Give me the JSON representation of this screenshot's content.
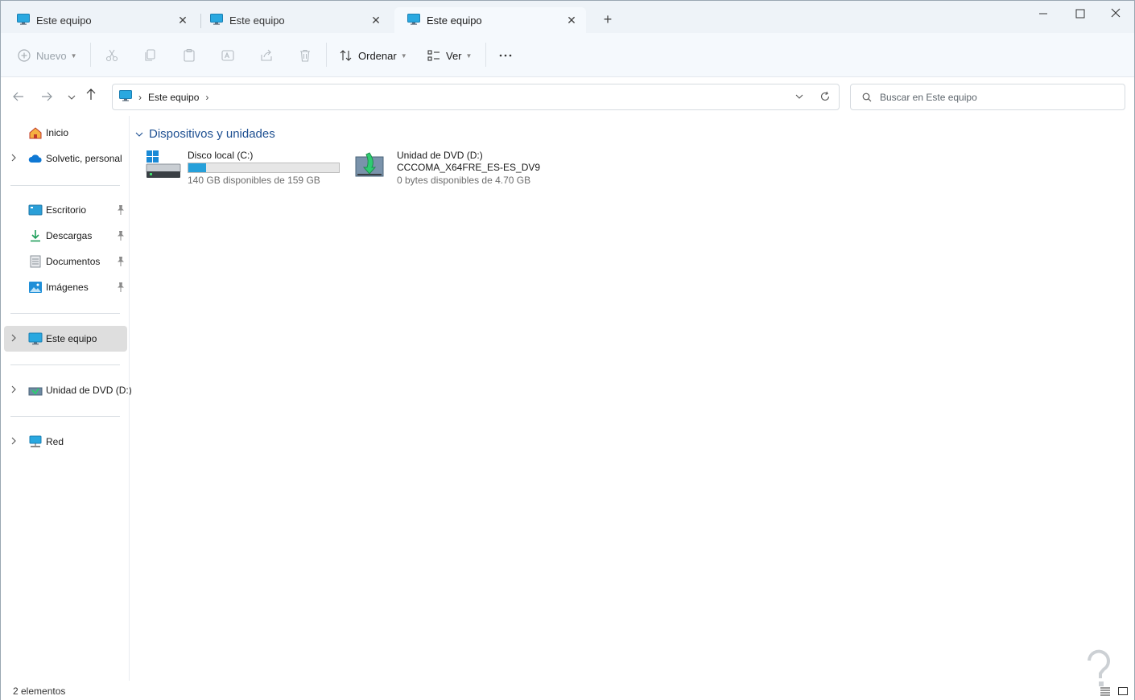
{
  "tabs": [
    {
      "label": "Este equipo",
      "active": false
    },
    {
      "label": "Este equipo",
      "active": false
    },
    {
      "label": "Este equipo",
      "active": true
    }
  ],
  "toolbar": {
    "new_label": "Nuevo",
    "sort_label": "Ordenar",
    "view_label": "Ver"
  },
  "address": {
    "crumbs": [
      "Este equipo"
    ]
  },
  "search": {
    "placeholder": "Buscar en Este equipo"
  },
  "sidebar": {
    "items": [
      {
        "label": "Inicio"
      },
      {
        "label": "Solvetic, personal"
      },
      {
        "label": "Escritorio"
      },
      {
        "label": "Descargas"
      },
      {
        "label": "Documentos"
      },
      {
        "label": "Imágenes"
      },
      {
        "label": "Este equipo"
      },
      {
        "label": "Unidad de DVD (D:)"
      },
      {
        "label": "Red"
      }
    ]
  },
  "content": {
    "group_title": "Dispositivos y unidades",
    "drives": [
      {
        "name": "Disco local (C:)",
        "info": "140 GB disponibles de 159 GB",
        "used_fraction": 0.12
      },
      {
        "name": "Unidad de DVD (D:)",
        "subtitle": "CCCOMA_X64FRE_ES-ES_DV9",
        "info": "0 bytes disponibles de 4.70 GB"
      }
    ]
  },
  "status": {
    "count": "2 elementos"
  },
  "colors": {
    "accent": "#26a0da",
    "group_title": "#1d4f91",
    "selected_bg": "#dedede"
  }
}
